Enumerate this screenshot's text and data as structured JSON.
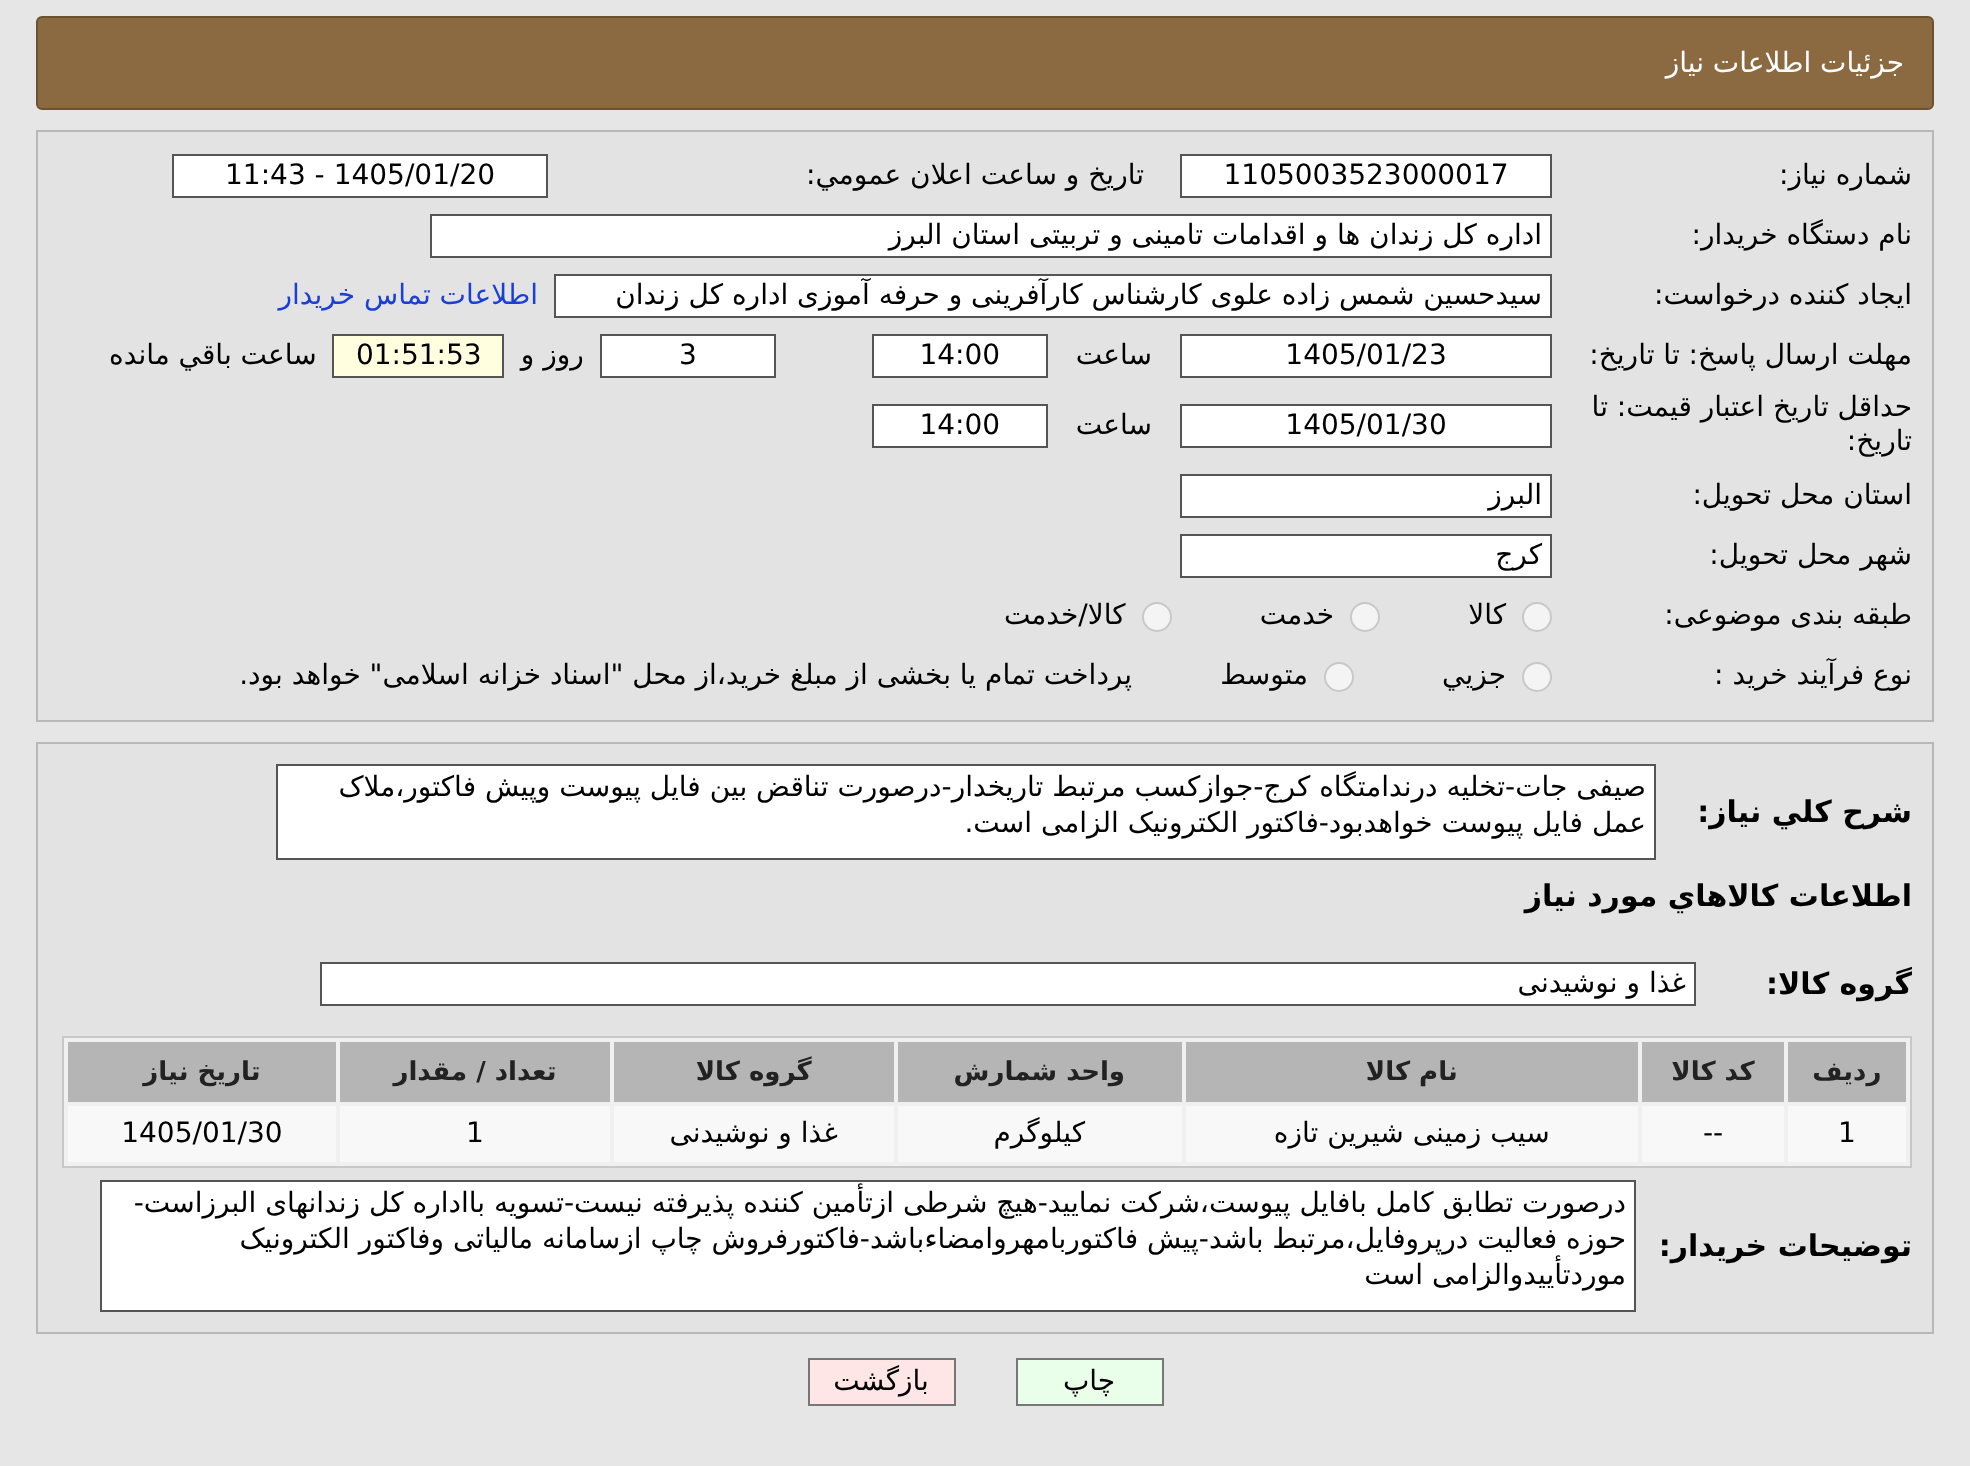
{
  "header": {
    "title": "جزئیات اطلاعات نیاز"
  },
  "need_number": {
    "label": "شماره نیاز:",
    "value": "1105003523000017"
  },
  "announce": {
    "label": "تاریخ و ساعت اعلان عمومي:",
    "value": "1405/01/20 - 11:43"
  },
  "buyer": {
    "label": "نام دستگاه خریدار:",
    "value": "اداره کل زندان ها و اقدامات تامینی و تربیتی استان البرز"
  },
  "creator": {
    "label": "ایجاد کننده درخواست:",
    "value": "سیدحسین شمس زاده علوی کارشناس کارآفرینی و حرفه آموزی اداره کل زندان",
    "link": "اطلاعات تماس خریدار"
  },
  "reply_deadline": {
    "label": "مهلت ارسال پاسخ: تا تاریخ:",
    "date": "1405/01/23",
    "time_label": "ساعت",
    "time": "14:00",
    "days": "3",
    "days_label": "روز و",
    "remaining": "01:51:53",
    "remaining_label": "ساعت باقي مانده"
  },
  "price_validity": {
    "label": "حداقل تاریخ اعتبار قیمت: تا تاریخ:",
    "date": "1405/01/30",
    "time_label": "ساعت",
    "time": "14:00"
  },
  "province": {
    "label": "استان محل تحویل:",
    "value": "البرز"
  },
  "city": {
    "label": "شهر محل تحویل:",
    "value": "کرج"
  },
  "category": {
    "label": "طبقه بندی موضوعی:",
    "options": [
      {
        "label": "کالا",
        "selected": false
      },
      {
        "label": "خدمت",
        "selected": false
      },
      {
        "label": "کالا/خدمت",
        "selected": false
      }
    ]
  },
  "purchase_type": {
    "label": "نوع فرآیند خرید :",
    "options": [
      {
        "label": "جزيي",
        "selected": false
      },
      {
        "label": "متوسط",
        "selected": false
      }
    ],
    "note": "پرداخت تمام یا بخشی از مبلغ خرید،از محل \"اسناد خزانه اسلامی\" خواهد بود."
  },
  "description": {
    "label": "شرح کلي نیاز:",
    "value": "صیفی جات-تخلیه درندامتگاه کرج-جوازکسب مرتبط تاریخدار-درصورت تناقض بین فایل پیوست وپیش فاکتور،ملاک عمل فایل پیوست خواهدبود-فاکتور الکترونیک الزامی است."
  },
  "goods_title": "اطلاعات کالاهاي مورد نیاز",
  "goods_group": {
    "label": "گروه کالا:",
    "value": "غذا و نوشیدنی"
  },
  "table": {
    "columns": [
      "ردیف",
      "کد کالا",
      "نام کالا",
      "واحد شمارش",
      "گروه کالا",
      "تعداد / مقدار",
      "تاریخ نیاز"
    ],
    "rows": [
      [
        "1",
        "--",
        "سیب زمینی شیرین تازه",
        "کیلوگرم",
        "غذا و نوشیدنی",
        "1",
        "1405/01/30"
      ]
    ]
  },
  "buyer_notes": {
    "label": "توضیحات خریدار:",
    "value": "درصورت تطابق کامل بافایل پیوست،شرکت نمایید-هیچ شرطی ازتأمین کننده پذیرفته نیست-تسویه بااداره کل زندانهای البرزاست-حوزه فعالیت درپروفایل،مرتبط باشد-پیش فاکتوربامهروامضاءباشد-فاکتورفروش چاپ ازسامانه مالیاتی وفاکتور الکترونیک موردتأییدوالزامی است"
  },
  "buttons": [
    {
      "label": "چاپ",
      "kind": "print"
    },
    {
      "label": "بازگشت",
      "kind": "back"
    }
  ]
}
